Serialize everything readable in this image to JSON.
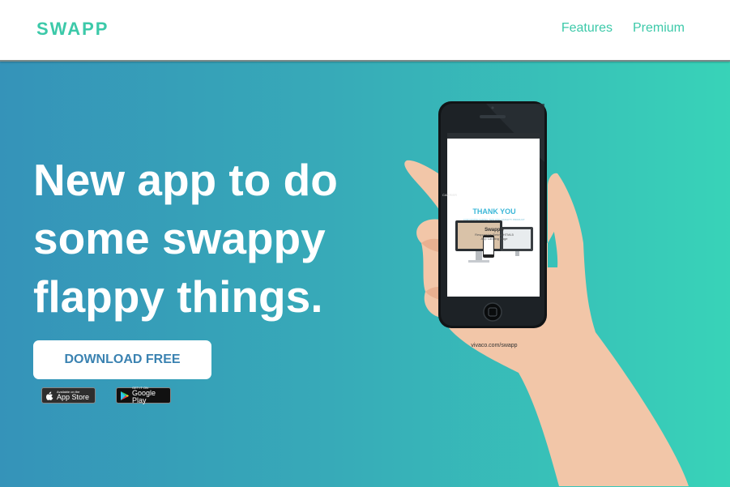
{
  "nav": {
    "logo": "SWAPP",
    "links": [
      "Features",
      "Premium"
    ]
  },
  "hero": {
    "headline_lines": [
      "New app to do",
      "some swappy",
      "flappy things."
    ],
    "cta_label": "DOWNLOAD FREE",
    "badges": {
      "appstore": {
        "small": "Available on the",
        "big": "App Store"
      },
      "googleplay": {
        "small": "GET IT ON",
        "big": "Google Play"
      }
    },
    "phone_screen": {
      "carrier": "CARRIER",
      "title": "THANK YOU",
      "tagline": "FOR DOWNLOADING THIS HIGH QUALITY PRODUCT",
      "product": "Swapp®",
      "subtitle_1": "Responsive Retina HTML5",
      "subtitle_2": "App Landing Page",
      "url": "vivaco.com/swapp"
    }
  },
  "colors": {
    "brand": "#3cc9a9",
    "gradient_start": "#3593b9",
    "gradient_end": "#38d3b8",
    "button_text": "#3a82b1"
  }
}
